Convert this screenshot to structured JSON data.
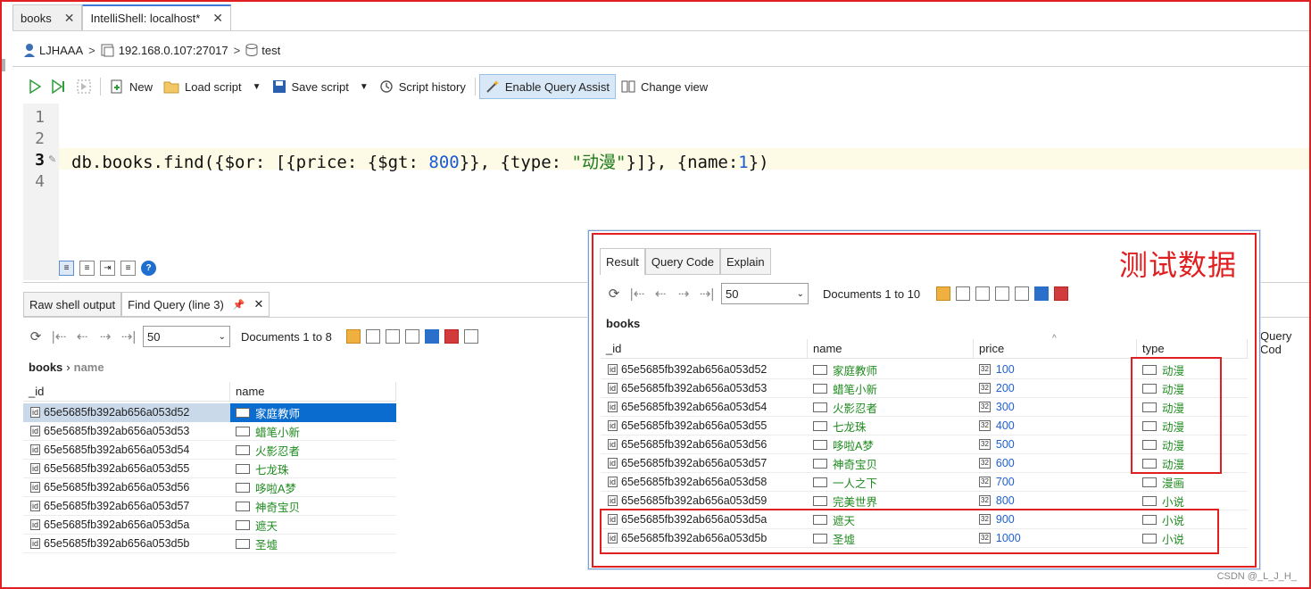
{
  "doc_tabs": [
    {
      "label": "books"
    },
    {
      "label": "IntelliShell: localhost*"
    }
  ],
  "breadcrumb": {
    "user": "LJHAAA",
    "server": "192.168.0.107:27017",
    "db": "test"
  },
  "toolbar": {
    "new_label": "New",
    "load_label": "Load script",
    "save_label": "Save script",
    "history_label": "Script history",
    "assist_label": "Enable Query Assist",
    "view_label": "Change view"
  },
  "editor": {
    "line_numbers": [
      "1",
      "2",
      "3",
      "4"
    ],
    "code": {
      "p1": "db.books.find({$or: [{price: {$gt: ",
      "n1": "800",
      "p2": "}}, {type: ",
      "s1": "\"动漫\"",
      "p3": "}]}, {name:",
      "n2": "1",
      "p4": "})"
    }
  },
  "result_tabs": [
    {
      "label": "Raw shell output"
    },
    {
      "label": "Find Query (line 3)"
    }
  ],
  "left_result": {
    "page_size": "50",
    "docs_label": "Documents 1 to 8",
    "path_collection": "books",
    "path_field": "name",
    "columns": [
      "_id",
      "name"
    ],
    "rows": [
      {
        "id": "65e5685fb392ab656a053d52",
        "name": "家庭教师"
      },
      {
        "id": "65e5685fb392ab656a053d53",
        "name": "蜡笔小新"
      },
      {
        "id": "65e5685fb392ab656a053d54",
        "name": "火影忍者"
      },
      {
        "id": "65e5685fb392ab656a053d55",
        "name": "七龙珠"
      },
      {
        "id": "65e5685fb392ab656a053d56",
        "name": "哆啦A梦"
      },
      {
        "id": "65e5685fb392ab656a053d57",
        "name": "神奇宝贝"
      },
      {
        "id": "65e5685fb392ab656a053d5a",
        "name": "遮天"
      },
      {
        "id": "65e5685fb392ab656a053d5b",
        "name": "圣墟"
      }
    ],
    "clipped_text": "Query Cod"
  },
  "overlay": {
    "annotation": "测试数据",
    "tabs": [
      {
        "label": "Result"
      },
      {
        "label": "Query Code"
      },
      {
        "label": "Explain"
      }
    ],
    "page_size": "50",
    "docs_label": "Documents 1 to 10",
    "collection": "books",
    "columns": [
      "_id",
      "name",
      "price",
      "type"
    ],
    "rows": [
      {
        "id": "65e5685fb392ab656a053d52",
        "name": "家庭教师",
        "price": "100",
        "type": "动漫"
      },
      {
        "id": "65e5685fb392ab656a053d53",
        "name": "蜡笔小新",
        "price": "200",
        "type": "动漫"
      },
      {
        "id": "65e5685fb392ab656a053d54",
        "name": "火影忍者",
        "price": "300",
        "type": "动漫"
      },
      {
        "id": "65e5685fb392ab656a053d55",
        "name": "七龙珠",
        "price": "400",
        "type": "动漫"
      },
      {
        "id": "65e5685fb392ab656a053d56",
        "name": "哆啦A梦",
        "price": "500",
        "type": "动漫"
      },
      {
        "id": "65e5685fb392ab656a053d57",
        "name": "神奇宝贝",
        "price": "600",
        "type": "动漫"
      },
      {
        "id": "65e5685fb392ab656a053d58",
        "name": "一人之下",
        "price": "700",
        "type": "漫画"
      },
      {
        "id": "65e5685fb392ab656a053d59",
        "name": "完美世界",
        "price": "800",
        "type": "小说"
      },
      {
        "id": "65e5685fb392ab656a053d5a",
        "name": "遮天",
        "price": "900",
        "type": "小说"
      },
      {
        "id": "65e5685fb392ab656a053d5b",
        "name": "圣墟",
        "price": "1000",
        "type": "小说"
      }
    ]
  },
  "watermark": "CSDN @_L_J_H_",
  "colors": {
    "annotation_red": "#e02020",
    "string_green": "#1f8a1f",
    "number_blue": "#1f5fd0",
    "selection_blue": "#0b6ccf"
  }
}
